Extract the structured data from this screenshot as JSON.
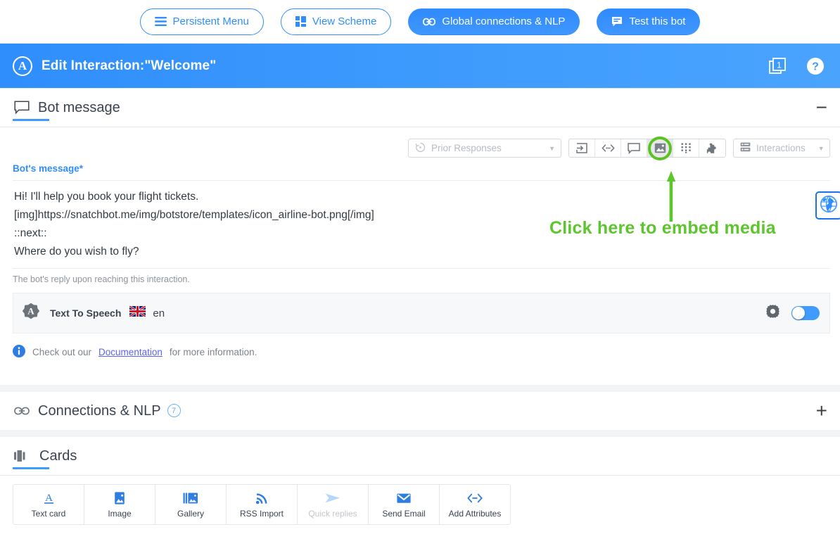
{
  "topbar": {
    "buttons": [
      {
        "label": "Persistent Menu",
        "icon": "hamburger-menu-icon",
        "style": "outline"
      },
      {
        "label": "View Scheme",
        "icon": "grid-scheme-icon",
        "style": "outline"
      },
      {
        "label": "Global connections & NLP",
        "icon": "link-chain-icon",
        "style": "filled"
      },
      {
        "label": "Test this bot",
        "icon": "chat-lines-icon",
        "style": "filled"
      }
    ]
  },
  "header": {
    "logo_letter": "A",
    "title": "Edit Interaction:\"Welcome\"",
    "copy_badge": "1",
    "help_label": "?"
  },
  "bot_message_section": {
    "title": "Bot message",
    "icon": "speech-bubble-icon",
    "collapse_symbol": "−",
    "toolbar": {
      "prior_responses": {
        "label": "Prior Responses",
        "caret": "▼",
        "icon": "history-clock-icon"
      },
      "icons": [
        "enter-box-icon",
        "code-brackets-icon",
        "chat-bubble-icon",
        "image-media-icon",
        "keypad-grid-icon",
        "puzzle-piece-icon"
      ],
      "highlighted_icon": "image-media-icon",
      "interactions": {
        "label": "Interactions",
        "caret": "▼",
        "icon": "interactions-list-icon"
      }
    },
    "field_label": "Bot's message",
    "field_required_mark": "*",
    "message_lines": [
      "Hi! I'll help you book your flight tickets.",
      "[img]https://snatchbot.me/img/botstore/templates/icon_airline-bot.png[/img]",
      "::next::",
      "Where do you wish to fly?"
    ],
    "field_hint": "The bot's reply upon reaching this interaction.",
    "tts": {
      "icon": "snatchbot-gear-a-icon",
      "label": "Text To Speech",
      "flag": "uk-flag-icon",
      "language": "en",
      "settings_icon": "gear-icon",
      "toggle_state": "off"
    },
    "documentation": {
      "icon": "info-circle-icon",
      "prefix": "Check out our",
      "link": "Documentation",
      "suffix": "for more information."
    }
  },
  "connections_section": {
    "title": "Connections & NLP",
    "icon": "link-chain-icon",
    "badge": "7",
    "expand_symbol": "+"
  },
  "cards_section": {
    "title": "Cards",
    "icon": "cards-stack-icon",
    "items": [
      {
        "label": "Text card",
        "icon": "text-a-icon",
        "disabled": false
      },
      {
        "label": "Image",
        "icon": "image-icon",
        "disabled": false
      },
      {
        "label": "Gallery",
        "icon": "gallery-icon",
        "disabled": false
      },
      {
        "label": "RSS Import",
        "icon": "rss-icon",
        "disabled": false
      },
      {
        "label": "Quick replies",
        "icon": "send-arrow-icon",
        "disabled": true
      },
      {
        "label": "Send Email",
        "icon": "envelope-icon",
        "disabled": false
      },
      {
        "label": "Add Attributes",
        "icon": "code-brackets-icon",
        "disabled": false
      }
    ]
  },
  "annotation": {
    "text": "Click here to embed media",
    "color": "#5dc52e",
    "arrow": "up-arrow-annotation"
  },
  "side_panel": {
    "globe_icon": "globe-language-icon"
  },
  "colors": {
    "brand_blue": "#2f8efc",
    "annotation_green": "#5dc52e",
    "text_dark": "#3b4351"
  }
}
